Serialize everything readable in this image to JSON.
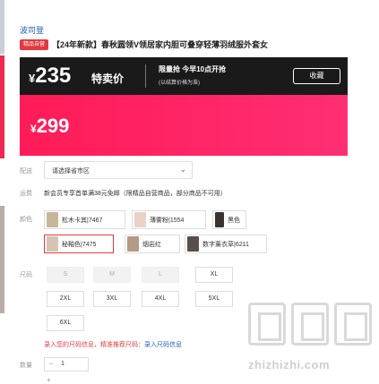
{
  "brand": "波司登",
  "badge": "精品自营",
  "title": "【24年新款】春秋圆领V领居家内胆可叠穿轻薄羽绒服外套女",
  "promo": {
    "yen": "¥",
    "price_now": "235",
    "special_label": "特卖价",
    "flash_title": "限量抢 今早10点开抢",
    "flash_sub": "(以结算价格为准)",
    "fav_label": "收藏"
  },
  "price_original": {
    "yen": "¥",
    "value": "299"
  },
  "labels": {
    "delivery": "配送",
    "shipping": "运费",
    "color": "颜色",
    "size": "尺码",
    "qty": "数量"
  },
  "delivery": {
    "placeholder": "请选择省市区"
  },
  "shipping_text": "新会员专享首单满38元免邮（限精品自营商品，部分商品不可用）",
  "colors": [
    {
      "name": "松木卡其|7467",
      "thumb": "#c7b79a",
      "active": false
    },
    {
      "name": "薄雾粉|1554",
      "thumb": "#e8d3c6",
      "active": false
    },
    {
      "name": "黑色",
      "thumb": "#3b3330",
      "active": false
    },
    {
      "name": "秘釉色|7475",
      "thumb": "#d6c3b3",
      "active": true
    },
    {
      "name": "烟岩红",
      "thumb": "#b29a86",
      "active": false
    },
    {
      "name": "数字薰衣草|6211",
      "thumb": "#5a4e48",
      "active": false
    }
  ],
  "sizes": [
    {
      "label": "S",
      "disabled": true
    },
    {
      "label": "M",
      "disabled": true
    },
    {
      "label": "L",
      "disabled": true
    },
    {
      "label": "XL",
      "disabled": false
    },
    {
      "label": "2XL",
      "disabled": false
    },
    {
      "label": "3XL",
      "disabled": false
    },
    {
      "label": "4XL",
      "disabled": false
    },
    {
      "label": "5XL",
      "disabled": false
    },
    {
      "label": "6XL",
      "disabled": false
    }
  ],
  "size_tip": "录入您的尺码信息，精准推荐尺码：",
  "size_tip_link": "录入尺码信息",
  "qty": {
    "minus": "−",
    "value": "1",
    "plus": "+"
  },
  "watermark": "zhizhizhi.com",
  "colors_theme": {
    "accent": "#e4393c",
    "pink": "#ff1b57",
    "link": "#1f5fbf"
  }
}
